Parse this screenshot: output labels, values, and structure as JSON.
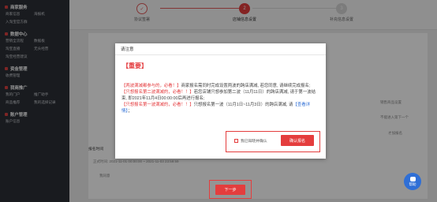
{
  "sidebar": {
    "sections": [
      {
        "title": "商家服务",
        "items": [
          [
            "商家信息",
            "海报机"
          ],
          [
            "入淘宝官方群",
            ""
          ]
        ]
      },
      {
        "title": "数据中心",
        "items": [
          [
            "营销全流程",
            "数据板"
          ],
          [
            "淘宝直播",
            "无头经营"
          ],
          [
            "淘宝经营建议",
            ""
          ]
        ]
      },
      {
        "title": "资金管理",
        "items": [
          [
            "收费管理",
            ""
          ]
        ]
      },
      {
        "title": "我商推广",
        "items": [
          [
            "我的门户",
            "推广助手"
          ],
          [
            "商品推荐",
            "我的选择记录"
          ]
        ]
      },
      {
        "title": "账户管理",
        "items": [
          [
            "账户信息",
            ""
          ]
        ]
      }
    ]
  },
  "steps": [
    {
      "label": "协议签署",
      "mark": "✓"
    },
    {
      "label": "店铺信息设置",
      "mark": "2"
    },
    {
      "label": "补充信息设置",
      "mark": "3"
    }
  ],
  "background": {
    "side_text_1": "销售商品设置",
    "side_text_2": "不能进入第下一个",
    "side_text_3": "才加报名",
    "label_reserve": "报名时间",
    "time_range": "正式时间: 2021-11-01 00:00:00 ~ 2021-11-03 23:59:59",
    "agree_text": "我同意",
    "next_button": "下一步"
  },
  "help_label": "帮助",
  "modal": {
    "header": "请注意",
    "title": "【重要】",
    "p1_red": "【两波满减都参与的，必看！】",
    "p1_text": "商家报名需同时完成设置两波的跨店满减, 若您同意, 请继续完成报名;",
    "p2_red": "【只想报名第二波满减的，必看！！】",
    "p2_text": "若您店铺只想参加第二波（11月11日）的跨店满减, 请于第一波结束, 即2021年11月4日00:00:00后再进行报名;",
    "p3_red": "【只想报名第一波满减的，必看！！】",
    "p3_text": "只想报名第一波（11月1日~11月3日）的跨店满减, 请",
    "p3_link": "【查看详情】",
    "p3_end": "；",
    "check_label": "我已知晓并确认",
    "confirm_button": "确认报名"
  }
}
